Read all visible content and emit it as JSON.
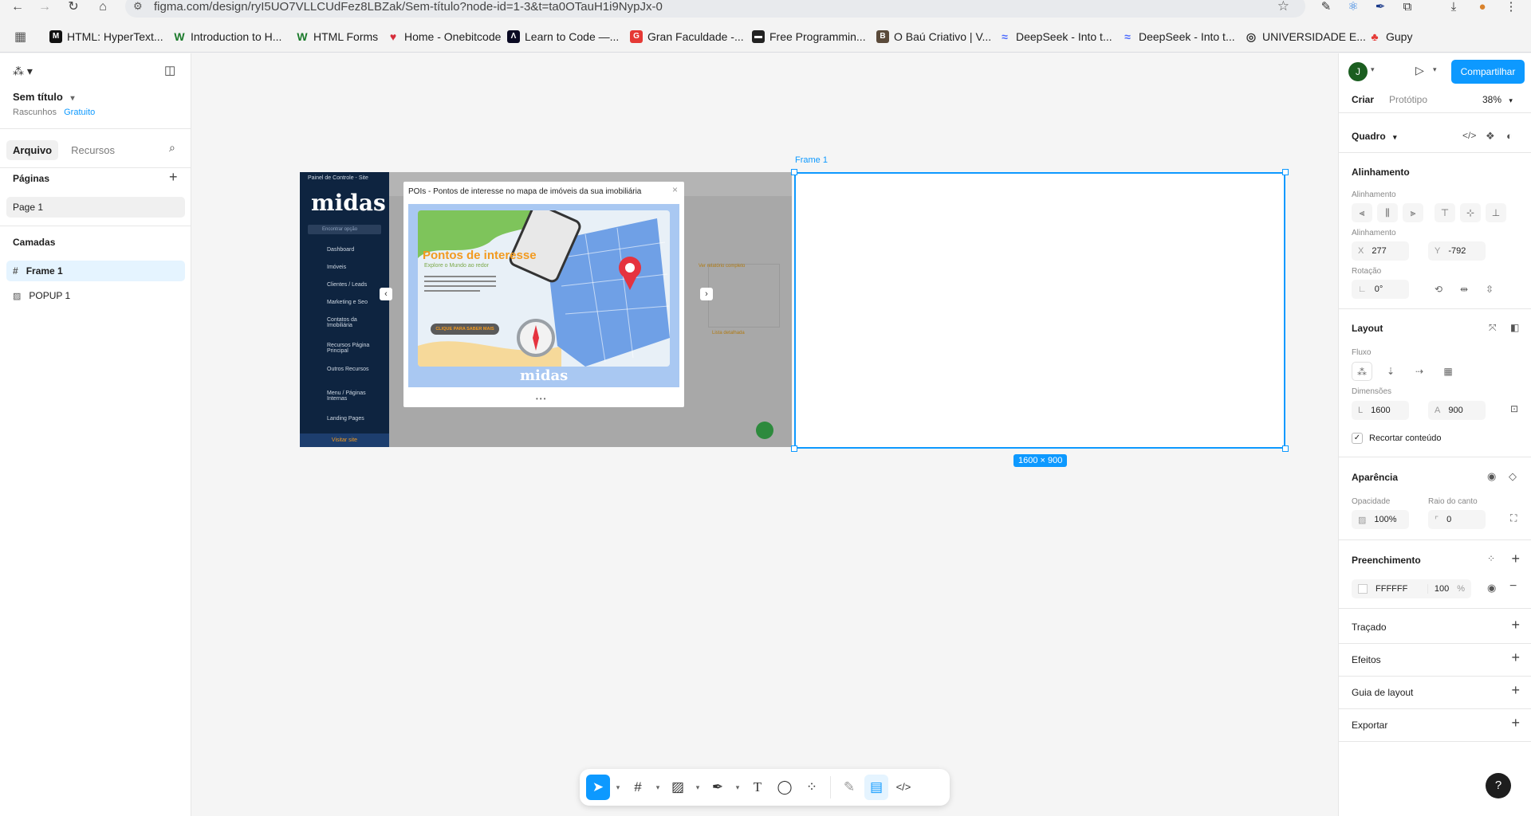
{
  "browser": {
    "url": "figma.com/design/ryI5UO7VLLCUdFez8LBZak/Sem-título?node-id=1-3&t=ta0OTauH1i9NypJx-0",
    "bookmarks": [
      {
        "label": "HTML: HyperText..."
      },
      {
        "label": "Introduction to H..."
      },
      {
        "label": "HTML Forms"
      },
      {
        "label": "Home - Onebitcode"
      },
      {
        "label": "Learn to Code —..."
      },
      {
        "label": "Gran Faculdade -..."
      },
      {
        "label": "Free Programmin..."
      },
      {
        "label": "O Baú Criativo | V..."
      },
      {
        "label": "DeepSeek - Into t..."
      },
      {
        "label": "DeepSeek - Into t..."
      },
      {
        "label": "UNIVERSIDADE E..."
      },
      {
        "label": "Gupy"
      }
    ]
  },
  "file": {
    "name": "Sem título",
    "location": "Rascunhos",
    "plan": "Gratuito"
  },
  "left_panel": {
    "tabs": [
      "Arquivo",
      "Recursos"
    ],
    "pages_title": "Páginas",
    "pages": [
      "Page 1"
    ],
    "layers_title": "Camadas",
    "layers": [
      {
        "name": "Frame 1",
        "type": "frame"
      },
      {
        "name": "POPUP 1",
        "type": "image"
      }
    ]
  },
  "right_panel": {
    "avatar_initial": "J",
    "share_label": "Compartilhar",
    "mode_tabs": [
      "Criar",
      "Protótipo"
    ],
    "zoom": "38%",
    "frame_type": "Quadro",
    "alignment": {
      "title": "Alinhamento",
      "sub1": "Alinhamento",
      "sub2": "Alinhamento",
      "x_label": "X",
      "x": "277",
      "y_label": "Y",
      "y": "-792",
      "rotation_label": "Rotação",
      "rotation": "0°"
    },
    "layout": {
      "title": "Layout",
      "flow_label": "Fluxo",
      "dimensions_label": "Dimensões",
      "w_label": "L",
      "w": "1600",
      "h_label": "A",
      "h": "900",
      "clip_label": "Recortar conteúdo"
    },
    "appearance": {
      "title": "Aparência",
      "opacity_label": "Opacidade",
      "opacity": "100%",
      "radius_label": "Raio do canto",
      "radius": "0"
    },
    "fill": {
      "title": "Preenchimento",
      "color": "FFFFFF",
      "opacity": "100",
      "pct": "%"
    },
    "sections": [
      "Traçado",
      "Efeitos",
      "Guia de layout",
      "Exportar"
    ]
  },
  "canvas": {
    "frame_label": "Frame 1",
    "frame_size": "1600 × 900",
    "popup": {
      "title": "POIs - Pontos de interesse no mapa de imóveis da sua imobiliária",
      "headline": "Pontos de interesse",
      "subheadline": "Explore o Mundo ao redor",
      "cta": "CLIQUE PARA SABER MAIS",
      "brand": "midas",
      "panel_title": "Painel de Controle - Site",
      "search_placeholder": "Encontrar opção",
      "menu": [
        "Dashboard",
        "Imóveis",
        "Clientes / Leads",
        "Marketing e Seo",
        "Contatos da Imobiliária",
        "Recursos Página Principal",
        "Outros Recursos",
        "Menu / Páginas Internas",
        "Landing Pages"
      ],
      "footer_link": "Visitar site",
      "link_report": "Ver relatório completo",
      "link_list": "Lista detalhada"
    }
  },
  "colors": {
    "accent": "#0d99ff",
    "frame_fill": "#FFFFFF",
    "sidebar_navy": "#0e2440",
    "popup_orange": "#f29a1f"
  }
}
